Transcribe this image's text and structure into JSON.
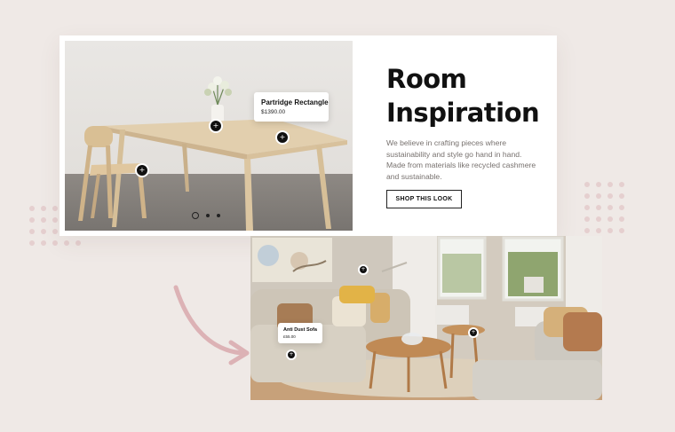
{
  "hero": {
    "title_line1": "Room",
    "title_line2": "Inspiration",
    "description": "We believe in crafting pieces where sustainability and style go hand in hand. Made from materials like recycled cashmere and sustainable.",
    "button_label": "SHOP THIS LOOK"
  },
  "product1": {
    "name": "Partridge Rectangle",
    "price": "$1390.00"
  },
  "product2": {
    "name": "Anti Dust Sofa",
    "price": "£55.00"
  },
  "hotspot_symbol": "+",
  "slider": {
    "count": 3,
    "active_index": 0
  },
  "colors": {
    "background": "#efe9e6",
    "accent_dots": "#e5cfcf",
    "arrow": "#dcb2b5",
    "text": "#111111",
    "muted_text": "#77716e"
  }
}
